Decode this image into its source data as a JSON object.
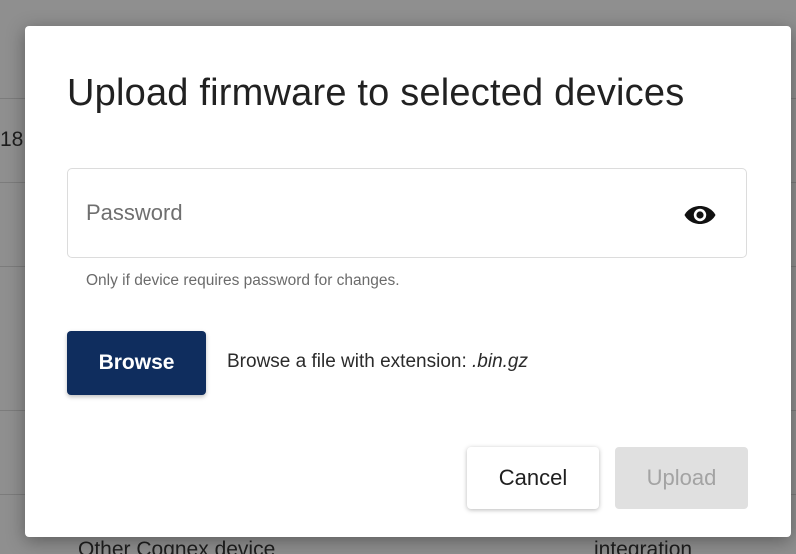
{
  "background": {
    "left_fragment": "18",
    "bottom_left_text": "Other Cognex device",
    "bottom_right_text": "integration"
  },
  "dialog": {
    "title": "Upload firmware to selected devices",
    "password": {
      "placeholder": "Password",
      "value": "",
      "helper": "Only if device requires password for changes."
    },
    "visibility_icon": "eye-icon",
    "browse_label": "Browse",
    "browse_hint_prefix": "Browse a file with extension: ",
    "browse_hint_extension": ".bin.gz",
    "cancel_label": "Cancel",
    "upload_label": "Upload",
    "upload_enabled": false
  },
  "colors": {
    "primary": "#0f2d5e",
    "disabled_bg": "#e0e0e0",
    "disabled_text": "#a3a3a3"
  }
}
